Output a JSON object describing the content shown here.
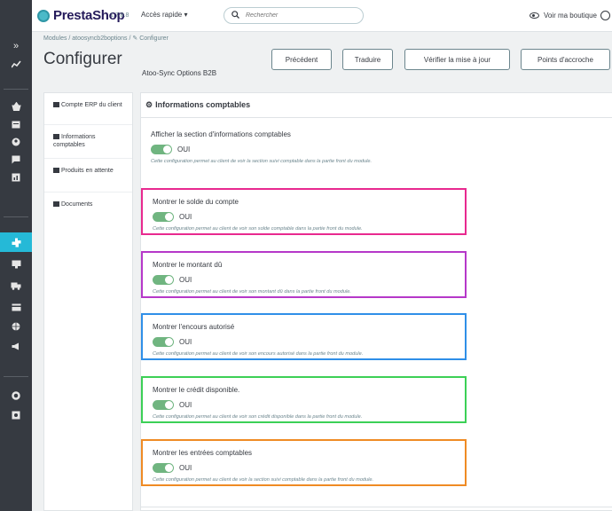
{
  "colors": {
    "pink": "#e8298f",
    "purple": "#b638c9",
    "blue": "#2f8fe8",
    "green": "#3cd056",
    "orange": "#ef8b24",
    "toggle": "#70b580",
    "accent": "#25b9d7"
  },
  "sidebar": {
    "icons": [
      "collapse-icon",
      "stats-icon",
      "orders-icon",
      "catalog-icon",
      "customers-icon",
      "messages-icon",
      "stats-chart-icon",
      "modules-icon",
      "design-icon",
      "shipping-icon",
      "payment-icon",
      "international-icon",
      "marketing-icon",
      "settings-icon",
      "advanced-icon"
    ]
  },
  "topbar": {
    "logo": "PrestaShop",
    "version": "1.7.8.8",
    "quick_access": "Accès rapide ▾",
    "search_placeholder": "Rechercher",
    "view_shop": "Voir ma boutique"
  },
  "header": {
    "breadcrumb": "Modules  /  atoosyncb2boptions  /  ✎ Configurer",
    "title": "Configurer",
    "module_name": "Atoo-Sync Options B2B",
    "buttons": {
      "previous": "Précédent",
      "translate": "Traduire",
      "check_update": "Vérifier la mise à jour",
      "hooks": "Points d'accroche"
    }
  },
  "tabs": [
    {
      "label": "Compte ERP du client",
      "icon": "account-icon"
    },
    {
      "label": "Informations comptables",
      "icon": "accounting-icon"
    },
    {
      "label": "Produits en attente",
      "icon": "pending-products-icon"
    },
    {
      "label": "Documents",
      "icon": "documents-icon"
    }
  ],
  "panel": {
    "title": "Informations comptables",
    "settings": [
      {
        "label": "Afficher la section d'informations comptables",
        "value": "OUI",
        "help": "Cette configuration permet au client de voir la section suivi comptable dans la partie front du module."
      },
      {
        "label": "Montrer le solde du compte",
        "value": "OUI",
        "help": "Cette configuration permet au client de voir son solde comptable dans la partie front du module."
      },
      {
        "label": "Montrer le montant dû",
        "value": "OUI",
        "help": "Cette configuration permet au client de voir son montant dû dans la partie front du module."
      },
      {
        "label": "Montrer l'encours autorisé",
        "value": "OUI",
        "help": "Cette configuration permet au client de voir son encours autorisé dans la partie front du module."
      },
      {
        "label": "Montrer le crédit disponible.",
        "value": "OUI",
        "help": "Cette configuration permet au client de voir son crédit disponible dans la partie front du module."
      },
      {
        "label": "Montrer les entrées comptables",
        "value": "OUI",
        "help": "Cette configuration permet au client de voir la section suivi comptable dans la partie front du module."
      }
    ]
  }
}
